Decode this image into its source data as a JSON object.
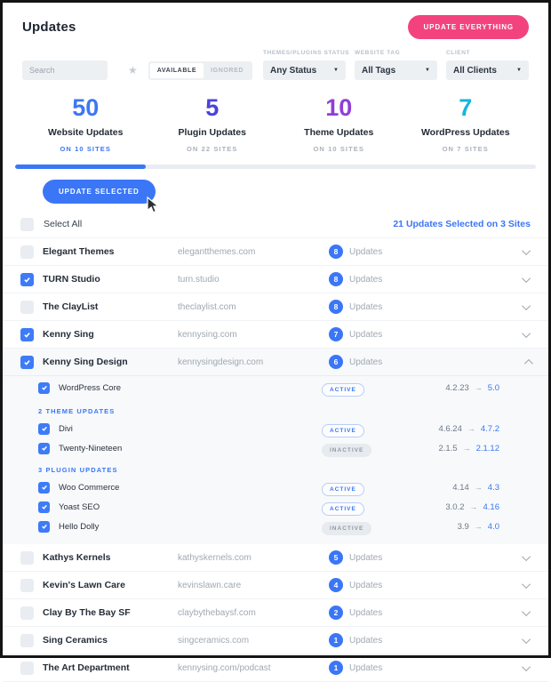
{
  "header": {
    "title": "Updates",
    "update_everything_label": "UPDATE EVERYTHING"
  },
  "filters": {
    "search_placeholder": "Search",
    "toggle": {
      "available": "AVAILABLE",
      "ignored": "IGNORED"
    },
    "dropdowns": [
      {
        "label": "THEMES/PLUGINS STATUS",
        "value": "Any Status"
      },
      {
        "label": "WEBSITE TAG",
        "value": "All Tags"
      },
      {
        "label": "CLIENT",
        "value": "All Clients"
      }
    ]
  },
  "stats": [
    {
      "count": "50",
      "label": "Website Updates",
      "sub": "ON 10 SITES",
      "color": "#3d77f3",
      "sub_active": true
    },
    {
      "count": "5",
      "label": "Plugin Updates",
      "sub": "ON 22 SITES",
      "color": "#4a43d9",
      "sub_active": false
    },
    {
      "count": "10",
      "label": "Theme Updates",
      "sub": "ON 10 SITES",
      "color": "#8f3fd6",
      "sub_active": false
    },
    {
      "count": "7",
      "label": "WordPress Updates",
      "sub": "ON 7 SITES",
      "color": "#16b5dd",
      "sub_active": false
    }
  ],
  "progress_percent": 25,
  "actions": {
    "update_selected_label": "UPDATE SELECTED",
    "select_all_label": "Select All",
    "selection_summary": "21 Updates Selected on 3 Sites"
  },
  "labels": {
    "updates_word": "Updates",
    "version_arrow": "→"
  },
  "colors": {
    "accent_blue": "#3b76f6",
    "accent_pink": "#f2437e"
  },
  "sites": [
    {
      "name": "Elegant Themes",
      "domain": "elegantthemes.com",
      "updates": "8",
      "checked": false,
      "expanded": false
    },
    {
      "name": "TURN Studio",
      "domain": "turn.studio",
      "updates": "8",
      "checked": true,
      "expanded": false
    },
    {
      "name": "The ClayList",
      "domain": "theclaylist.com",
      "updates": "8",
      "checked": false,
      "expanded": false
    },
    {
      "name": "Kenny Sing",
      "domain": "kennysing.com",
      "updates": "7",
      "checked": true,
      "expanded": false
    },
    {
      "name": "Kenny Sing Design",
      "domain": "kennysingdesign.com",
      "updates": "6",
      "checked": true,
      "expanded": true,
      "detail": {
        "core": {
          "name": "WordPress Core",
          "status": "ACTIVE",
          "old": "4.2.23",
          "new": "5.0",
          "checked": true
        },
        "groups": [
          {
            "label": "2 THEME UPDATES",
            "items": [
              {
                "name": "Divi",
                "status": "ACTIVE",
                "old": "4.6.24",
                "new": "4.7.2",
                "checked": true
              },
              {
                "name": "Twenty-Nineteen",
                "status": "INACTIVE",
                "old": "2.1.5",
                "new": "2.1.12",
                "checked": true
              }
            ]
          },
          {
            "label": "3 PLUGIN UPDATES",
            "items": [
              {
                "name": "Woo Commerce",
                "status": "ACTIVE",
                "old": "4.14",
                "new": "4.3",
                "checked": true
              },
              {
                "name": "Yoast SEO",
                "status": "ACTIVE",
                "old": "3.0.2",
                "new": "4.16",
                "checked": true
              },
              {
                "name": "Hello Dolly",
                "status": "INACTIVE",
                "old": "3.9",
                "new": "4.0",
                "checked": true
              }
            ]
          }
        ]
      }
    },
    {
      "name": "Kathys Kernels",
      "domain": "kathyskernels.com",
      "updates": "5",
      "checked": false,
      "expanded": false
    },
    {
      "name": "Kevin's Lawn Care",
      "domain": "kevinslawn.care",
      "updates": "4",
      "checked": false,
      "expanded": false
    },
    {
      "name": "Clay By The Bay SF",
      "domain": "claybythebaysf.com",
      "updates": "2",
      "checked": false,
      "expanded": false
    },
    {
      "name": "Sing Ceramics",
      "domain": "singceramics.com",
      "updates": "1",
      "checked": false,
      "expanded": false
    },
    {
      "name": "The Art Department",
      "domain": "kennysing.com/podcast",
      "updates": "1",
      "checked": false,
      "expanded": false
    }
  ]
}
